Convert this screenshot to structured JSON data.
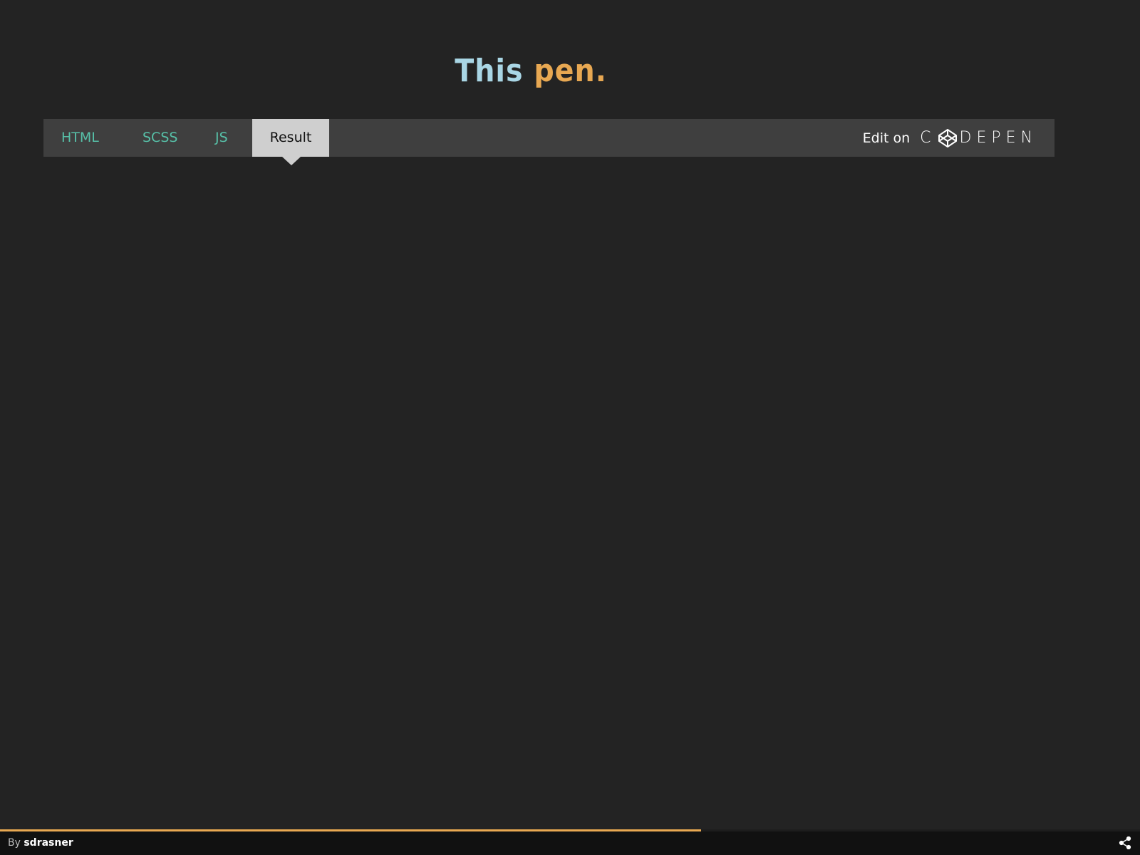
{
  "heading": {
    "word1": "This",
    "word2": "pen."
  },
  "tabs": [
    {
      "label": "HTML"
    },
    {
      "label": "SCSS"
    },
    {
      "label": "JS"
    },
    {
      "label": "Result",
      "active": true
    }
  ],
  "edit_on": {
    "label": "Edit on",
    "logo_text_start": "C",
    "logo_text_end": "DEPEN"
  },
  "footer": {
    "by_label": "By",
    "author": "sdrasner",
    "progress": 0.615
  },
  "colors": {
    "background": "#232323",
    "bar": "#3f3f3f",
    "tab_text": "#57c0a8",
    "active_tab": "#cfcfcf",
    "heading_word1": "#a9d6e5",
    "heading_word2": "#e8a852",
    "progress": "#e8a852"
  },
  "icons": {
    "codepen_logo": "codepen-logo-icon",
    "share": "share-icon"
  }
}
